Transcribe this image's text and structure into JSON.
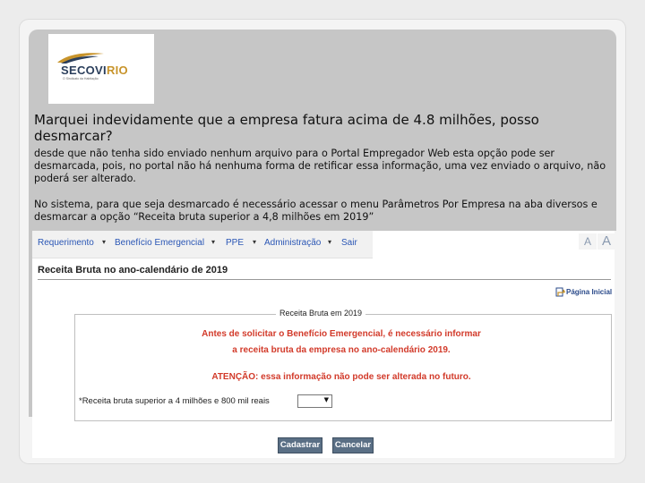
{
  "logo": {
    "brand_part1": "SECOVI",
    "brand_part2": "RIO",
    "tagline": "O Sindicato da Habitação"
  },
  "slide": {
    "question": "Marquei indevidamente que a empresa fatura acima de 4.8 milhões, posso desmarcar?",
    "answer_p1": "desde que não tenha sido enviado nenhum arquivo para o Portal Empregador Web esta opção pode ser desmarcada, pois, no portal não há nenhuma forma de retificar essa informação, uma vez enviado o arquivo, não poderá ser alterado.",
    "answer_p2": "No sistema, para que seja desmarcado é necessário acessar o menu Parâmetros Por Empresa na aba diversos e desmarcar a opção “Receita bruta superior a 4,8 milhões em 2019”"
  },
  "menu": {
    "items": [
      {
        "label": "Requerimento"
      },
      {
        "label": "Benefício Emergencial"
      },
      {
        "label": "PPE"
      },
      {
        "label": "Administração"
      },
      {
        "label": "Sair"
      }
    ],
    "font_small": "A",
    "font_large": "A"
  },
  "page": {
    "title": "Receita Bruta no ano-calendário de 2019",
    "home_link": "Página Inicial"
  },
  "form": {
    "legend": "Receita Bruta em 2019",
    "warning_line1": "Antes de solicitar o Benefício Emergencial, é necessário informar",
    "warning_line2": "a receita bruta da empresa no ano-calendário 2019.",
    "warning_line3": "ATENÇÃO: essa informação não pode ser alterada no futuro.",
    "field_label": "*Receita bruta superior a 4 milhões e 800 mil reais",
    "select_value": "",
    "submit_label": "Cadastrar",
    "cancel_label": "Cancelar"
  },
  "colors": {
    "warning": "#d23a2a",
    "link": "#2a56b5",
    "button": "#5a6f85",
    "brand_navy": "#2b3f5c",
    "brand_gold": "#c8942b"
  }
}
